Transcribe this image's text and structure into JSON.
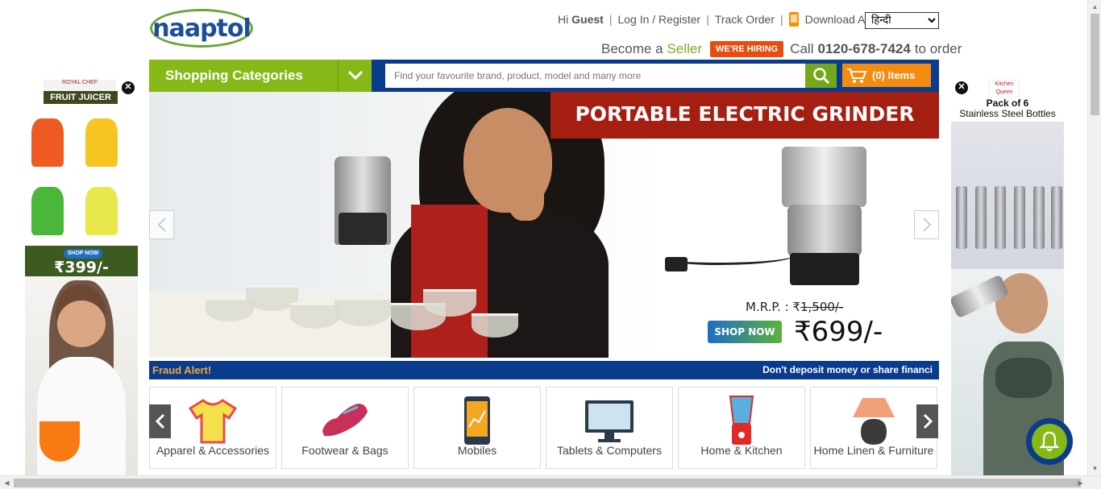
{
  "header": {
    "logo_text": "naaptol",
    "greeting_prefix": "Hi",
    "greeting_user": "Guest",
    "login_label": "Log In / Register",
    "track_order_label": "Track Order",
    "download_app_label": "Download App",
    "language_selected": "हिन्दी",
    "become_label": "Become a",
    "seller_label": "Seller",
    "hiring_badge": "WE'RE HIRING",
    "call_label": "Call",
    "phone_number": "0120-678-7424",
    "to_order_label": "to order"
  },
  "nav": {
    "categories_label": "Shopping Categories",
    "search_placeholder": "Find your favourite brand, product, model and many more",
    "cart_label": "(0) Items"
  },
  "banner": {
    "title": "PORTABLE ELECTRIC GRINDER",
    "mrp_label": "M.R.P. : ₹",
    "mrp_value": "1,500/-",
    "shop_now": "SHOP NOW",
    "price": "₹699/-"
  },
  "fraud": {
    "title": "Fraud Alert!",
    "message": "Don't deposit money or share financi"
  },
  "categories": [
    {
      "label": "Apparel & Accessories",
      "icon": "tshirt-icon"
    },
    {
      "label": "Footwear & Bags",
      "icon": "shoe-icon"
    },
    {
      "label": "Mobiles",
      "icon": "mobile-icon"
    },
    {
      "label": "Tablets & Computers",
      "icon": "monitor-icon"
    },
    {
      "label": "Home & Kitchen",
      "icon": "blender-icon"
    },
    {
      "label": "Home Linen & Furniture",
      "icon": "lamp-icon"
    }
  ],
  "ad_left": {
    "brand": "ROYAL CHEF",
    "product": "FRUIT JUICER",
    "shop_now": "SHOP NOW",
    "price": "₹399/-"
  },
  "ad_right": {
    "brand": "Kitchen Queen",
    "headline": "Pack of 6",
    "subline": "Stainless Steel Bottles"
  },
  "colors": {
    "brand_blue": "#0b3b8c",
    "brand_green": "#86b818",
    "accent_orange": "#f38c10",
    "banner_red": "#a51e12"
  }
}
